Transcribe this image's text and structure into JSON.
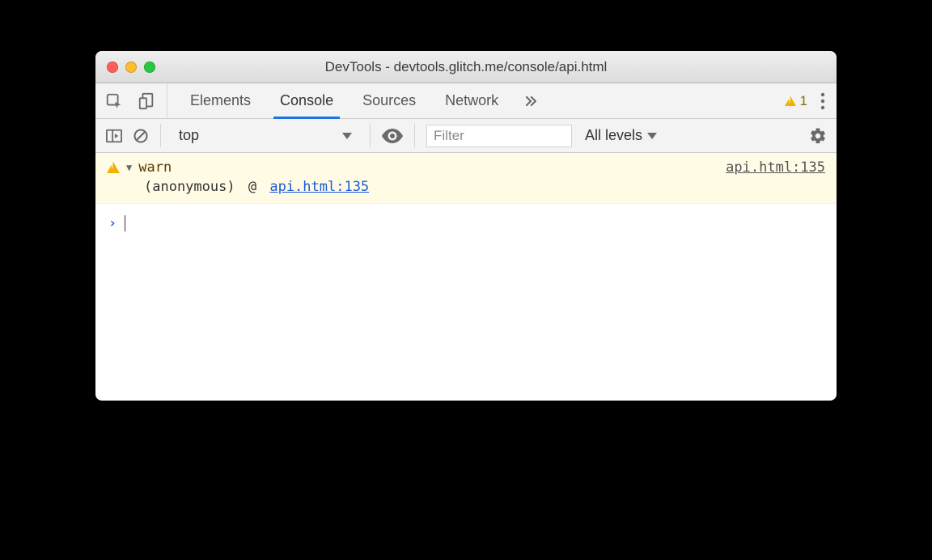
{
  "titlebar": {
    "title": "DevTools - devtools.glitch.me/console/api.html"
  },
  "tabs": {
    "elements": "Elements",
    "console": "Console",
    "sources": "Sources",
    "network": "Network"
  },
  "warnings": {
    "count": "1"
  },
  "contoolbar": {
    "context": "top",
    "filter_placeholder": "Filter",
    "levels": "All levels"
  },
  "log": {
    "warn": {
      "message": "warn",
      "source": "api.html:135",
      "stack_fn": "(anonymous)",
      "stack_at": "@",
      "stack_loc": "api.html:135"
    }
  }
}
